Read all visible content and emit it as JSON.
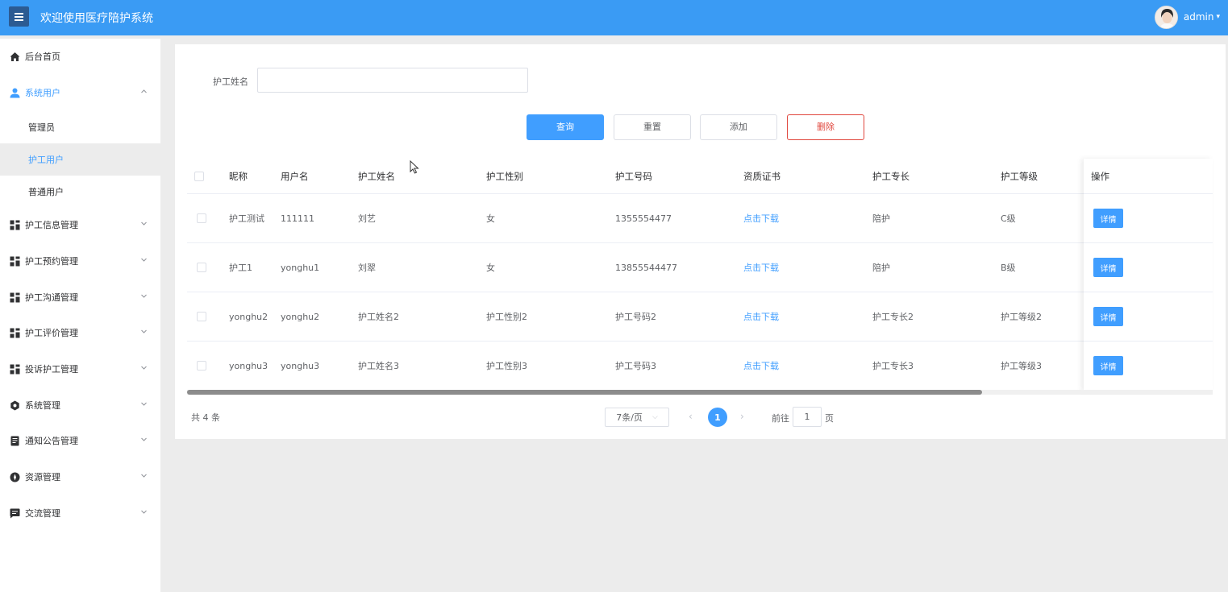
{
  "header": {
    "title": "欢迎使用医疗陪护系统",
    "user_name": "admin",
    "colors": {
      "header_bg": "#3a9bf4",
      "menu_button_bg": "#2c5b92",
      "accent": "#409eff",
      "danger": "#e0463d"
    }
  },
  "sidebar": {
    "items": [
      {
        "label": "后台首页",
        "icon": "home-icon"
      },
      {
        "label": "系统用户",
        "icon": "user-icon",
        "expanded": true,
        "children": [
          {
            "label": "管理员"
          },
          {
            "label": "护工用户",
            "selected": true
          },
          {
            "label": "普通用户"
          }
        ]
      },
      {
        "label": "护工信息管理",
        "icon": "grid-icon"
      },
      {
        "label": "护工预约管理",
        "icon": "grid-icon"
      },
      {
        "label": "护工沟通管理",
        "icon": "grid-icon"
      },
      {
        "label": "护工评价管理",
        "icon": "grid-icon"
      },
      {
        "label": "投诉护工管理",
        "icon": "grid-icon"
      },
      {
        "label": "系统管理",
        "icon": "settings-icon"
      },
      {
        "label": "通知公告管理",
        "icon": "document-icon"
      },
      {
        "label": "资源管理",
        "icon": "compass-icon"
      },
      {
        "label": "交流管理",
        "icon": "message-icon"
      }
    ]
  },
  "search": {
    "label": "护工姓名",
    "value": "",
    "placeholder": ""
  },
  "buttons": {
    "query": "查询",
    "reset": "重置",
    "add": "添加",
    "delete": "删除"
  },
  "table": {
    "columns": [
      "昵称",
      "用户名",
      "护工姓名",
      "护工性别",
      "护工号码",
      "资质证书",
      "护工专长",
      "护工等级",
      "操作"
    ],
    "rows": [
      {
        "nickname": "护工测试",
        "username": "111111",
        "name": "刘艺",
        "gender": "女",
        "phone": "1355554477",
        "cert": "点击下载",
        "specialty": "陪护",
        "level": "C级",
        "action": "详情"
      },
      {
        "nickname": "护工1",
        "username": "yonghu1",
        "name": "刘翠",
        "gender": "女",
        "phone": "13855544477",
        "cert": "点击下载",
        "specialty": "陪护",
        "level": "B级",
        "action": "详情"
      },
      {
        "nickname": "yonghu2",
        "username": "yonghu2",
        "name": "护工姓名2",
        "gender": "护工性别2",
        "phone": "护工号码2",
        "cert": "点击下载",
        "specialty": "护工专长2",
        "level": "护工等级2",
        "action": "详情"
      },
      {
        "nickname": "yonghu3",
        "username": "yonghu3",
        "name": "护工姓名3",
        "gender": "护工性别3",
        "phone": "护工号码3",
        "cert": "点击下载",
        "specialty": "护工专长3",
        "level": "护工等级3",
        "action": "详情"
      }
    ]
  },
  "pagination": {
    "total": "共 4 条",
    "page_size": "7条/页",
    "current_page": "1",
    "goto_label": "前往",
    "goto_value": "1",
    "goto_suffix": "页"
  }
}
